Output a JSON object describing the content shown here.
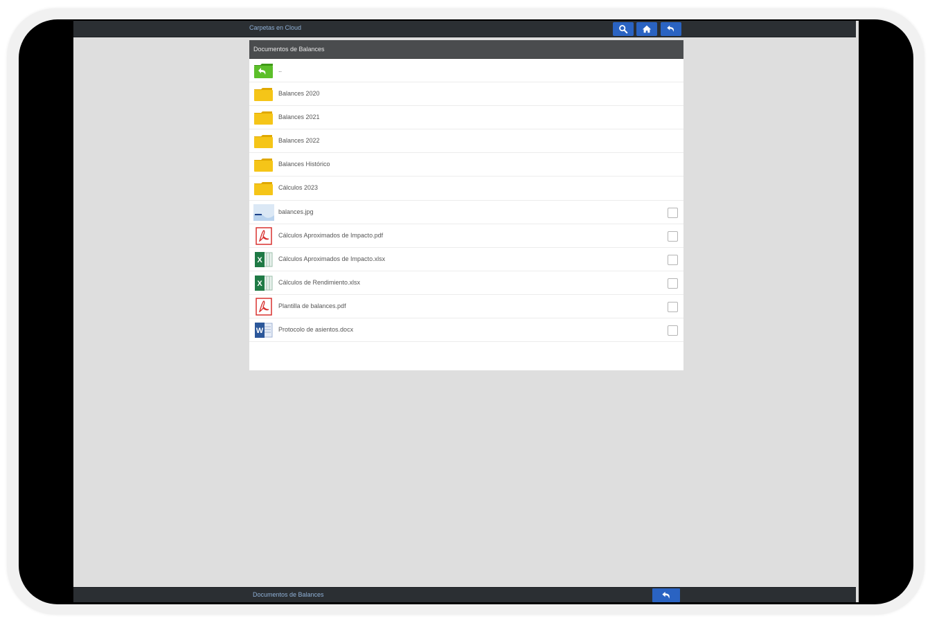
{
  "app": {
    "top_title": "Carpetas en Cloud",
    "bottom_title": "Documentos de Balances"
  },
  "toolbar": {
    "buttons": [
      {
        "icon": "search-icon"
      },
      {
        "icon": "home-icon"
      },
      {
        "icon": "back-icon"
      }
    ]
  },
  "panel": {
    "title": "Documentos de Balances",
    "rows": [
      {
        "label": "..",
        "icon": "folder-up-icon",
        "checkbox": false
      },
      {
        "label": "Balances 2020",
        "icon": "folder-icon",
        "checkbox": false
      },
      {
        "label": "Balances 2021",
        "icon": "folder-icon",
        "checkbox": false
      },
      {
        "label": "Balances 2022",
        "icon": "folder-icon",
        "checkbox": false
      },
      {
        "label": "Balances Histórico",
        "icon": "folder-icon",
        "checkbox": false
      },
      {
        "label": "Cálculos 2023",
        "icon": "folder-icon",
        "checkbox": false
      },
      {
        "label": "balances.jpg",
        "icon": "image-file-icon",
        "checkbox": true
      },
      {
        "label": "Cálculos Aproximados de Impacto.pdf",
        "icon": "pdf-file-icon",
        "checkbox": true
      },
      {
        "label": "Cálculos Aproximados de Impacto.xlsx",
        "icon": "excel-file-icon",
        "checkbox": true
      },
      {
        "label": "Cálculos de Rendimiento.xlsx",
        "icon": "excel-file-icon",
        "checkbox": true
      },
      {
        "label": "Plantilla de balances.pdf",
        "icon": "pdf-file-icon",
        "checkbox": true
      },
      {
        "label": "Protocolo de asientos.docx",
        "icon": "word-file-icon",
        "checkbox": true
      }
    ]
  },
  "colors": {
    "toolbar_bg": "#2b2f33",
    "accent_button": "#2a63c2",
    "panel_header": "#4a4c4e",
    "screen_bg": "#dedede",
    "folder": "#f5c518",
    "up_folder": "#5cbf2a",
    "pdf": "#d8312f",
    "excel": "#1f7a45",
    "word": "#2b579a"
  }
}
